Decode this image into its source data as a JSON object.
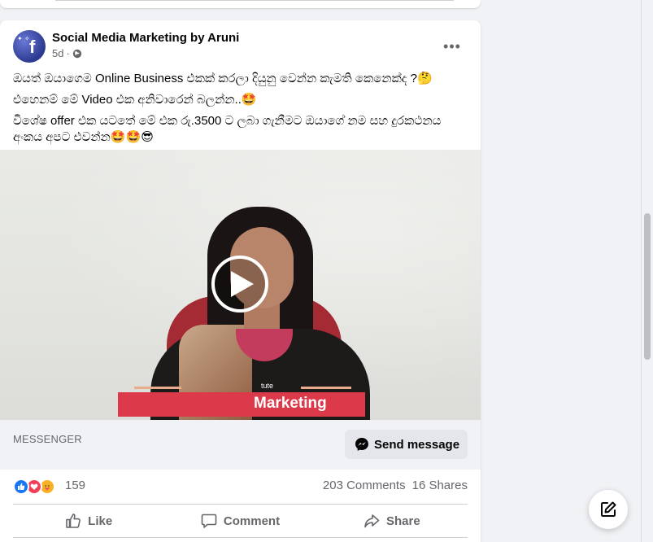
{
  "post": {
    "page_name": "Social Media Marketing by Aruni",
    "time": "5d",
    "separator": "·",
    "text_line1": "ඔයත් ඔයාගෙම Online Business එකක් කරලා දියුනු වෙන්න කැමති කෙනෙක්ද ?",
    "text_line1_emoji": "🤔",
    "text_line2": "එහෙනම් මේ  Video එක අනිවාරෙන් බලන්න..",
    "text_line2_emoji": "🤩",
    "text_line3": "විශේෂ offer එක යටතේ මේ එක රු.3500 ට ලබා ගැනීමට ඔයාගේ නම සහ දුරකථනය අංකය අපට එවන්න",
    "text_line3_emoji": "🤩🤩😎"
  },
  "video": {
    "overlay_small": "tute",
    "overlay_title": "Marketing"
  },
  "cta": {
    "label": "MESSENGER",
    "button": "Send message"
  },
  "stats": {
    "reaction_count": "159",
    "comments": "203 Comments",
    "shares": "16 Shares"
  },
  "actions": {
    "like": "Like",
    "comment": "Comment",
    "share": "Share"
  },
  "icons": {
    "more": "more-horizontal-icon",
    "audience": "globe-icon",
    "play": "play-icon",
    "messenger": "messenger-icon",
    "like": "thumbs-up-icon",
    "comment": "comment-icon",
    "share": "share-arrow-icon",
    "compose": "compose-edit-icon"
  },
  "colors": {
    "brand_blue": "#1877f2",
    "love_red": "#f33e58",
    "care_yellow": "#f7b125",
    "banner_red": "#dc3a4a"
  }
}
